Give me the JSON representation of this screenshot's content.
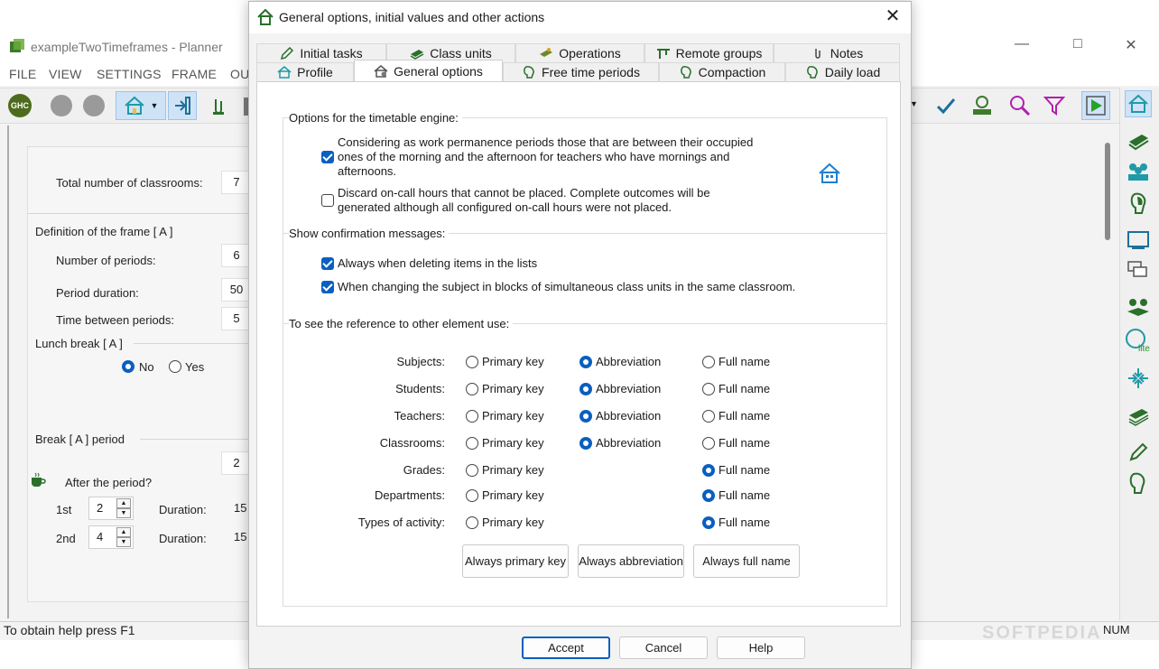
{
  "app": {
    "title": "exampleTwoTimeframes - Planner",
    "menu": [
      "FILE",
      "VIEW",
      "SETTINGS",
      "FRAME",
      "OU"
    ],
    "status_help": "To obtain help press F1",
    "status_num": "NUM",
    "toolbar_ghc": "GHC"
  },
  "left_panel": {
    "total_classrooms_label": "Total number of classrooms:",
    "total_classrooms_value": "7",
    "frame_def_label": "Definition of the frame [ A ]",
    "num_periods_label": "Number of periods:",
    "num_periods_value": "6",
    "period_duration_label": "Period duration:",
    "period_duration_value": "50",
    "time_between_label": "Time between periods:",
    "time_between_value": "5",
    "lunch_break_label": "Lunch break [ A ]",
    "lunch_no": "No",
    "lunch_yes": "Yes",
    "break_period_label": "Break [ A ]  period",
    "break_period_value": "2",
    "after_period_label": "After the period?",
    "first_label": "1st",
    "first_value": "2",
    "second_label": "2nd",
    "second_value": "4",
    "duration_label": "Duration:",
    "duration_value_1": "15",
    "duration_value_2": "15"
  },
  "dialog": {
    "title": "General options, initial values and other actions",
    "tabs_row1": [
      "Initial tasks",
      "Class units",
      "Operations",
      "Remote groups",
      "Notes"
    ],
    "tabs_row2": [
      "Profile",
      "General options",
      "Free time periods",
      "Compaction",
      "Daily load"
    ],
    "active_tab": "General options",
    "engine_section": "Options for the timetable engine:",
    "engine_opt1": "Considering as work permanence periods those that are between their occupied ones of the morning and the afternoon for teachers who have mornings and afternoons.",
    "engine_opt1_checked": true,
    "engine_opt2": "Discard on-call hours that cannot be placed. Complete outcomes will be generated although all configured on-call hours were not placed.",
    "engine_opt2_checked": false,
    "confirm_section": "Show confirmation messages:",
    "confirm_opt1": "Always when deleting items in the lists",
    "confirm_opt1_checked": true,
    "confirm_opt2": "When changing the subject in blocks of simultaneous class units in the same classroom.",
    "confirm_opt2_checked": true,
    "reference_section": "To see the reference to other element use:",
    "option_primary": "Primary key",
    "option_abbrev": "Abbreviation",
    "option_full": "Full name",
    "reference_rows": [
      {
        "label": "Subjects:",
        "selected": "abbreviation",
        "has_abbrev": true
      },
      {
        "label": "Students:",
        "selected": "abbreviation",
        "has_abbrev": true
      },
      {
        "label": "Teachers:",
        "selected": "abbreviation",
        "has_abbrev": true
      },
      {
        "label": "Classrooms:",
        "selected": "abbreviation",
        "has_abbrev": true
      },
      {
        "label": "Grades:",
        "selected": "full",
        "has_abbrev": false
      },
      {
        "label": "Departments:",
        "selected": "full",
        "has_abbrev": false
      },
      {
        "label": "Types of activity:",
        "selected": "full",
        "has_abbrev": false
      }
    ],
    "btn_always_primary": "Always primary key",
    "btn_always_abbrev": "Always abbreviation",
    "btn_always_full": "Always full name",
    "btn_accept": "Accept",
    "btn_cancel": "Cancel",
    "btn_help": "Help"
  },
  "colors": {
    "accent": "#0a5fc0",
    "icon_green": "#3c7a2c",
    "icon_teal": "#1f9aa8"
  },
  "watermark": "SOFTPEDIA"
}
